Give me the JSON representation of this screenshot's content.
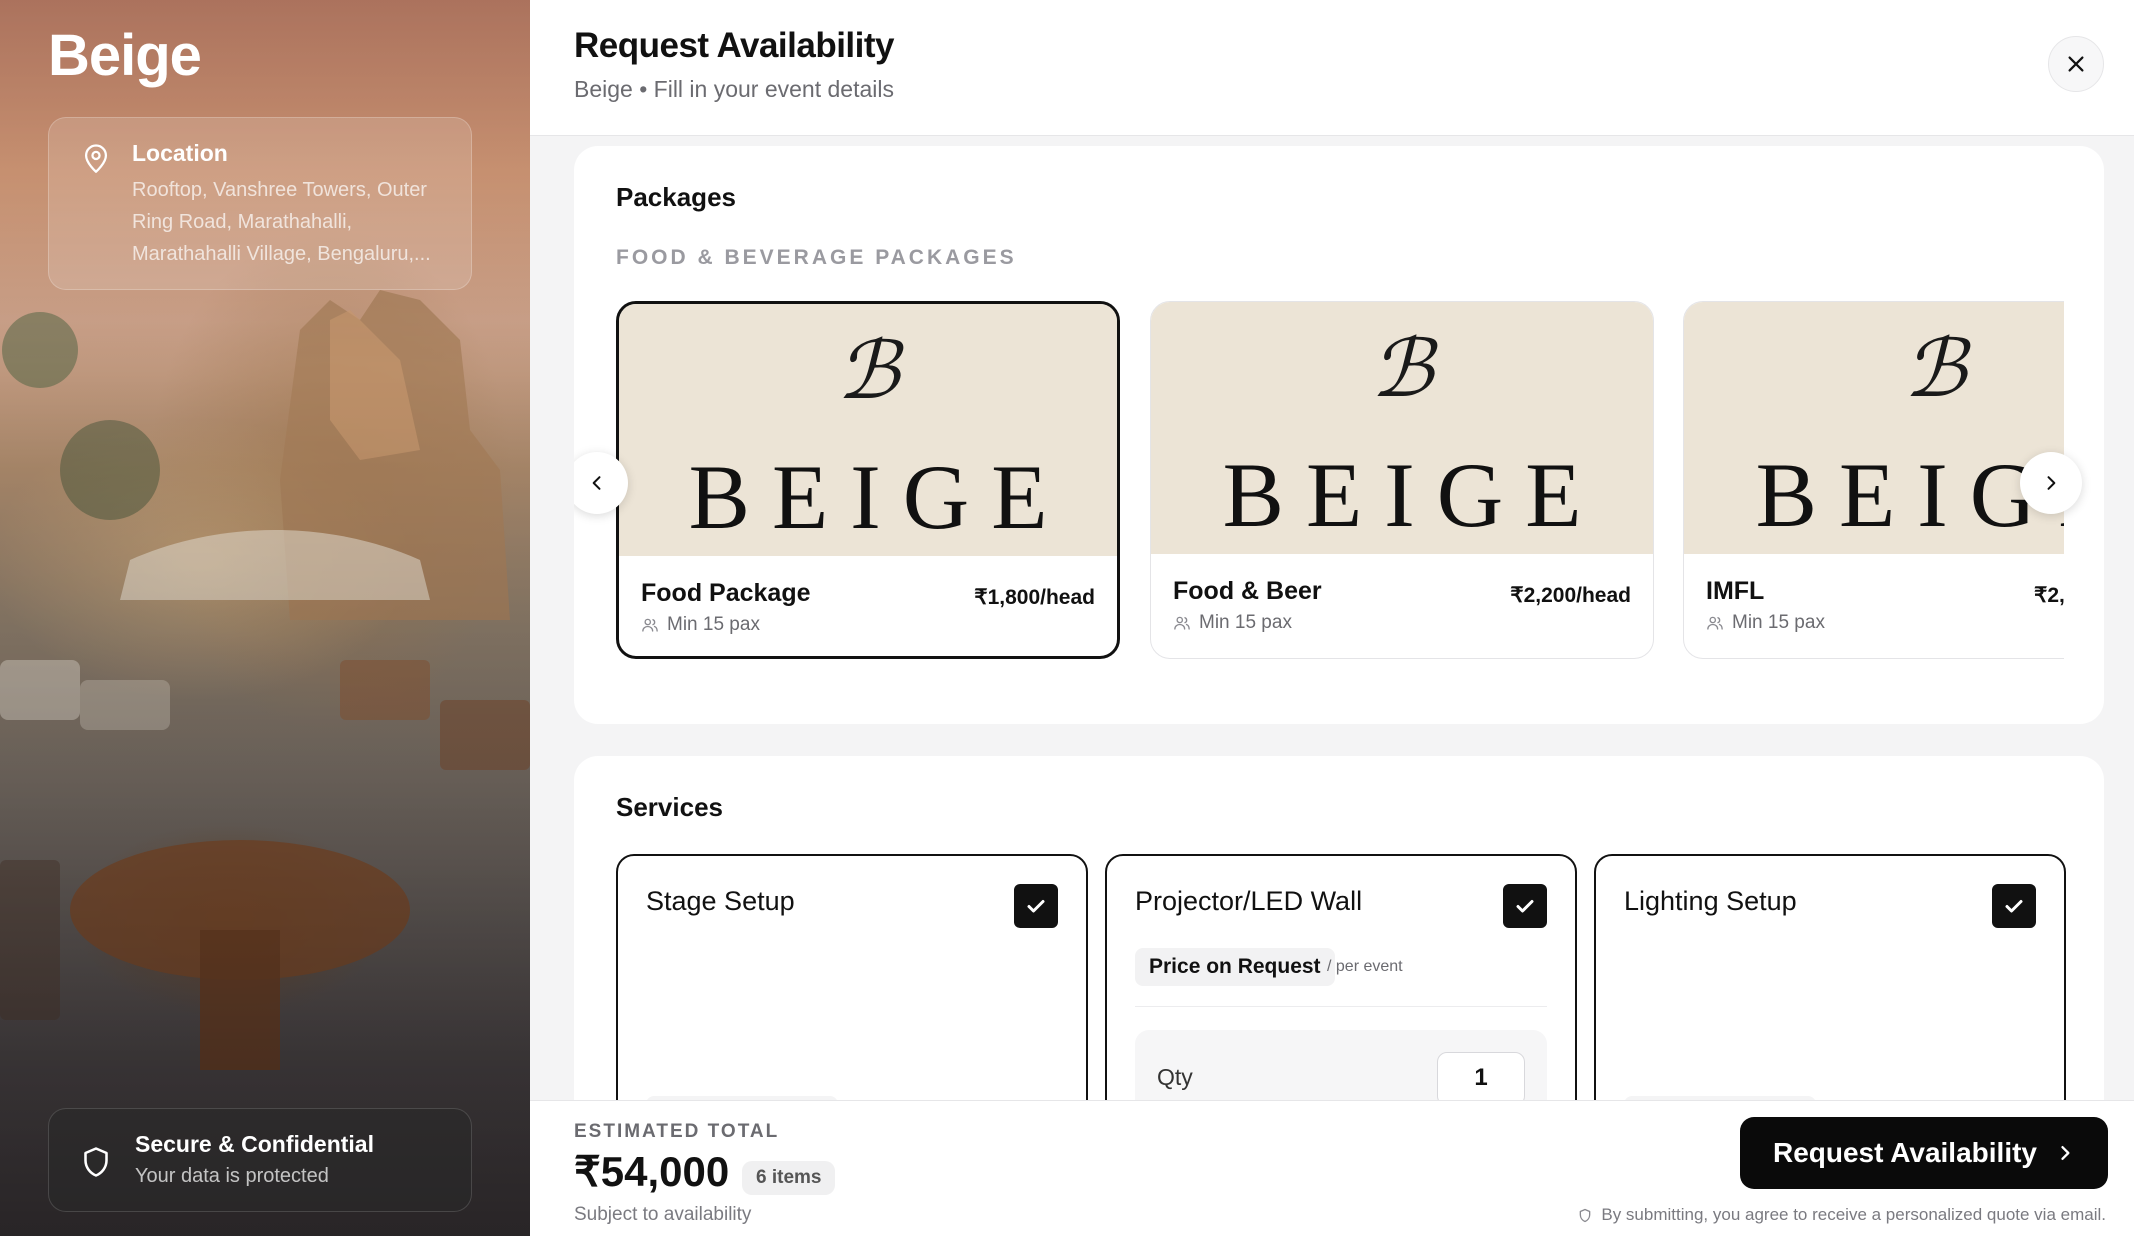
{
  "sidebar": {
    "brand": "Beige",
    "location": {
      "title": "Location",
      "address": "Rooftop, Vanshree Towers, Outer Ring Road, Marathahalli, Marathahalli Village, Bengaluru,..."
    },
    "secure": {
      "title": "Secure & Confidential",
      "subtitle": "Your data is protected"
    }
  },
  "header": {
    "title": "Request Availability",
    "subtitle": "Beige • Fill in your event details"
  },
  "packages": {
    "title": "Packages",
    "subheading": "FOOD & BEVERAGE PACKAGES",
    "image_mono": "ℬ",
    "image_word": "BEIGE",
    "items": [
      {
        "name": "Food Package",
        "min": "Min 15 pax",
        "price": "₹1,800/head",
        "selected": true
      },
      {
        "name": "Food & Beer",
        "min": "Min 15 pax",
        "price": "₹2,200/head",
        "selected": false
      },
      {
        "name": "IMFL",
        "min": "Min 15 pax",
        "price": "₹2,",
        "selected": false
      }
    ]
  },
  "services": {
    "title": "Services",
    "items": [
      {
        "name": "Stage Setup",
        "checked": true
      },
      {
        "name": "Projector/LED Wall",
        "checked": true,
        "price_label": "Price on Request",
        "unit": "/ per event",
        "qty_label": "Qty",
        "qty": "1"
      },
      {
        "name": "Lighting Setup",
        "checked": true
      }
    ]
  },
  "footer": {
    "estimated_label": "ESTIMATED TOTAL",
    "total": "₹54,000",
    "items_count": "6 items",
    "subject": "Subject to availability",
    "cta_label": "Request Availability",
    "disclaimer": "By submitting, you agree to receive a personalized quote via email."
  },
  "colors": {
    "primary": "#0a0a0a",
    "panel_bg": "#f4f4f5",
    "muted_text": "#6b6b70",
    "image_bg": "#ece4d6"
  }
}
